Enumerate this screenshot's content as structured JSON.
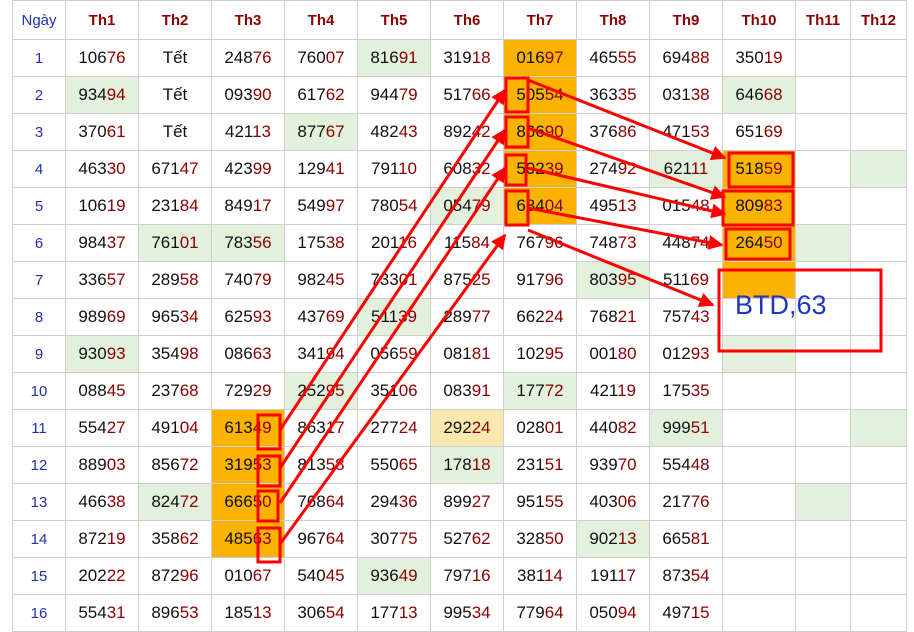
{
  "header": {
    "day": "Ngày",
    "months": [
      "Th1",
      "Th2",
      "Th3",
      "Th4",
      "Th5",
      "Th6",
      "Th7",
      "Th8",
      "Th9",
      "Th10",
      "Th11",
      "Th12"
    ]
  },
  "rows": [
    {
      "day": "1",
      "cells": [
        "10676",
        "Tết",
        "24876",
        "76007",
        "81691",
        "31918",
        "01697",
        "46555",
        "69488",
        "35019",
        "",
        ""
      ]
    },
    {
      "day": "2",
      "cells": [
        "93494",
        "Tết",
        "09390",
        "61762",
        "94479",
        "51766",
        "50554",
        "36335",
        "03138",
        "64668",
        "",
        ""
      ]
    },
    {
      "day": "3",
      "cells": [
        "37061",
        "Tết",
        "42113",
        "87767",
        "48243",
        "89242",
        "86690",
        "37686",
        "47153",
        "65169",
        "",
        ""
      ]
    },
    {
      "day": "4",
      "cells": [
        "46330",
        "67147",
        "42399",
        "12941",
        "79110",
        "60832",
        "50239",
        "27492",
        "62111",
        "51859",
        "",
        ""
      ]
    },
    {
      "day": "5",
      "cells": [
        "10619",
        "23184",
        "84917",
        "54997",
        "78054",
        "05479",
        "68404",
        "49513",
        "01548",
        "80983",
        "",
        ""
      ]
    },
    {
      "day": "6",
      "cells": [
        "98437",
        "76101",
        "78356",
        "17538",
        "20116",
        "11584",
        "76796",
        "74873",
        "44874",
        "26450",
        "",
        ""
      ]
    },
    {
      "day": "7",
      "cells": [
        "33657",
        "28958",
        "74079",
        "98245",
        "73301",
        "87525",
        "91796",
        "80395",
        "51169",
        "",
        "",
        ""
      ]
    },
    {
      "day": "8",
      "cells": [
        "98969",
        "96534",
        "62593",
        "43769",
        "51139",
        "28977",
        "66224",
        "76821",
        "75743",
        "",
        "",
        ""
      ]
    },
    {
      "day": "9",
      "cells": [
        "93093",
        "35498",
        "08663",
        "34194",
        "05659",
        "08181",
        "10295",
        "00180",
        "01293",
        "",
        "",
        ""
      ]
    },
    {
      "day": "10",
      "cells": [
        "08845",
        "23768",
        "72929",
        "25295",
        "35106",
        "08391",
        "17772",
        "42119",
        "17535",
        "",
        "",
        ""
      ]
    },
    {
      "day": "11",
      "cells": [
        "55427",
        "49104",
        "61349",
        "86317",
        "27724",
        "29224",
        "02801",
        "44082",
        "99951",
        "",
        "",
        ""
      ]
    },
    {
      "day": "12",
      "cells": [
        "88903",
        "85672",
        "31953",
        "81358",
        "55065",
        "17818",
        "23151",
        "93970",
        "55448",
        "",
        "",
        ""
      ]
    },
    {
      "day": "13",
      "cells": [
        "46638",
        "82472",
        "66650",
        "76864",
        "29436",
        "89927",
        "95155",
        "40306",
        "21776",
        "",
        "",
        ""
      ]
    },
    {
      "day": "14",
      "cells": [
        "87219",
        "35862",
        "48563",
        "96764",
        "30775",
        "52762",
        "32850",
        "90213",
        "66581",
        "",
        "",
        ""
      ]
    },
    {
      "day": "15",
      "cells": [
        "20222",
        "87296",
        "01067",
        "54045",
        "93649",
        "79716",
        "38114",
        "19117",
        "87354",
        "",
        "",
        ""
      ]
    },
    {
      "day": "16",
      "cells": [
        "55431",
        "89653",
        "18513",
        "30654",
        "17713",
        "99534",
        "77964",
        "05094",
        "49715",
        "",
        "",
        ""
      ]
    }
  ],
  "highlights": {
    "green": [
      "0-4",
      "1-0",
      "1-9",
      "2-3",
      "3-8",
      "3-11",
      "4-5",
      "5-1",
      "5-2",
      "5-10",
      "6-7",
      "7-4",
      "8-0",
      "8-9",
      "9-3",
      "9-6",
      "10-8",
      "10-11",
      "11-5",
      "12-1",
      "12-10",
      "13-7",
      "14-4"
    ],
    "orange": [
      "0-6",
      "1-6",
      "2-6",
      "3-6",
      "4-6",
      "3-9",
      "4-9",
      "5-9",
      "6-9",
      "10-2",
      "11-2",
      "12-2",
      "13-2"
    ],
    "yellow": [
      "10-5"
    ]
  },
  "annotation": {
    "label": "BTD,63"
  },
  "colors": {
    "header_text": "#8b0000",
    "day_text": "#2030b0",
    "tail_text": "#8b0000",
    "green": "#e2f0dc",
    "orange": "#f9b300",
    "arrow": "#ff0000",
    "label": "#1f35c8"
  }
}
